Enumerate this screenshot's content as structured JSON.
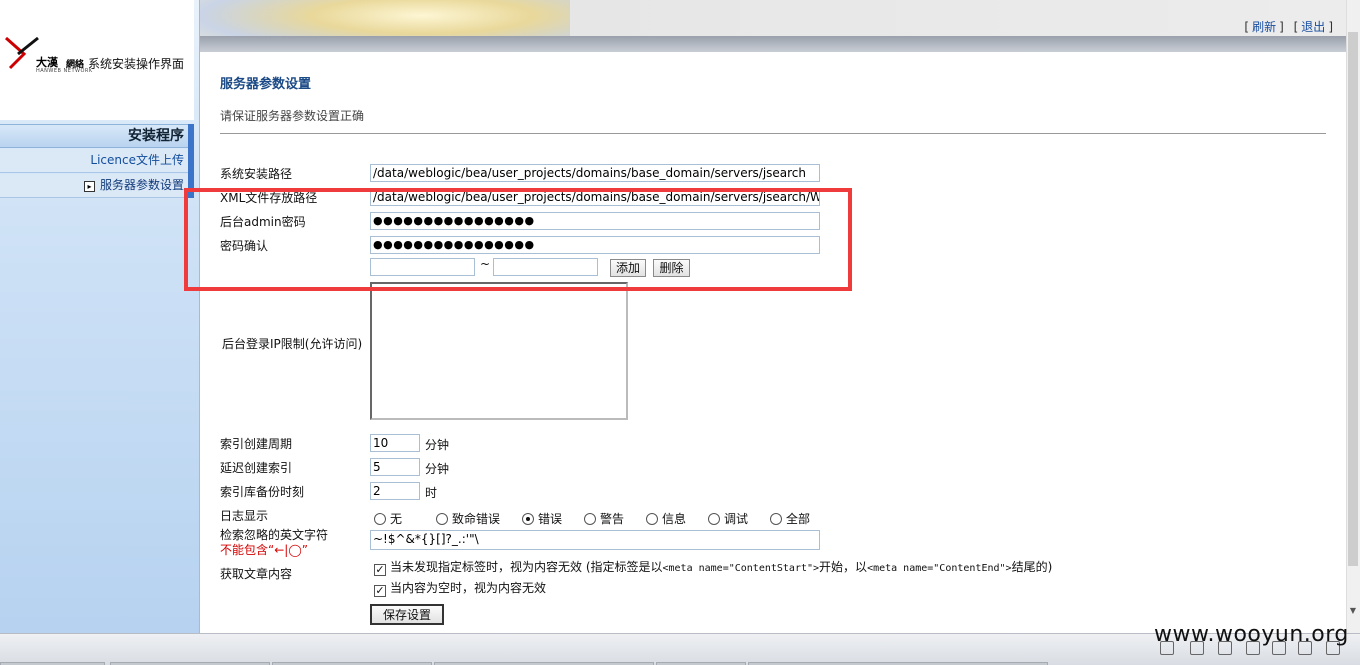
{
  "logo": {
    "brand": "大漢",
    "brand_net": "網絡",
    "subtitle": "系统安装操作界面",
    "english": "HANWEB NETWORK"
  },
  "sidebar": {
    "header": "安装程序",
    "items": [
      {
        "label": "Licence文件上传"
      },
      {
        "label": "服务器参数设置",
        "icon": "arrow-box-icon"
      }
    ]
  },
  "toplinks": {
    "refresh": "刷新",
    "logout": "退出",
    "open": "[",
    "close": "]"
  },
  "page": {
    "title": "服务器参数设置",
    "subtitle": "请保证服务器参数设置正确"
  },
  "form": {
    "install_path": {
      "label": "系统安装路径",
      "value": "/data/weblogic/bea/user_projects/domains/base_domain/servers/jsearch"
    },
    "xml_path": {
      "label": "XML文件存放路径",
      "value": "/data/weblogic/bea/user_projects/domains/base_domain/servers/jsearch/WEB"
    },
    "admin_password": {
      "label": "后台admin密码",
      "value": "●●●●●●●●●●●●●●●●"
    },
    "password_confirm": {
      "label": "密码确认",
      "value": "●●●●●●●●●●●●●●●●"
    },
    "ip_range": {
      "from": "",
      "to": "",
      "separator": "~",
      "add_label": "添加",
      "delete_label": "删除"
    },
    "ip_limit": {
      "label": "后台登录IP限制(允许访问)"
    },
    "index_cycle": {
      "label": "索引创建周期",
      "value": "10",
      "unit": "分钟"
    },
    "delay_index": {
      "label": "延迟创建索引",
      "value": "5",
      "unit": "分钟"
    },
    "backup_time": {
      "label": "索引库备份时刻",
      "value": "2",
      "unit": "时"
    },
    "log_display": {
      "label": "日志显示",
      "options": [
        "无",
        "致命错误",
        "错误",
        "警告",
        "信息",
        "调试",
        "全部"
      ],
      "selected": "错误"
    },
    "ignore_chars": {
      "label": "检索忽略的英文字符",
      "warning": "不能包含“←|◯”",
      "value": "~!$^&*{}[]?_.:'\"\\"
    },
    "fetch_content": {
      "label": "获取文章内容",
      "checks": [
        {
          "pre": "当未发现指定标签时，视为内容无效 (指定标签是以",
          "code1": "<meta name=\"ContentStart\">",
          "mid": "开始，以",
          "code2": "<meta name=\"ContentEnd\">",
          "post": "结尾的)",
          "checked": true
        },
        {
          "pre": "当内容为空时，视为内容无效",
          "checked": true
        }
      ]
    },
    "save_label": "保存设置"
  },
  "watermark": "www.wooyun.org",
  "colors": {
    "highlight": "#ef3b3b",
    "title_blue": "#1b4a86",
    "warning_red": "#d40000"
  }
}
